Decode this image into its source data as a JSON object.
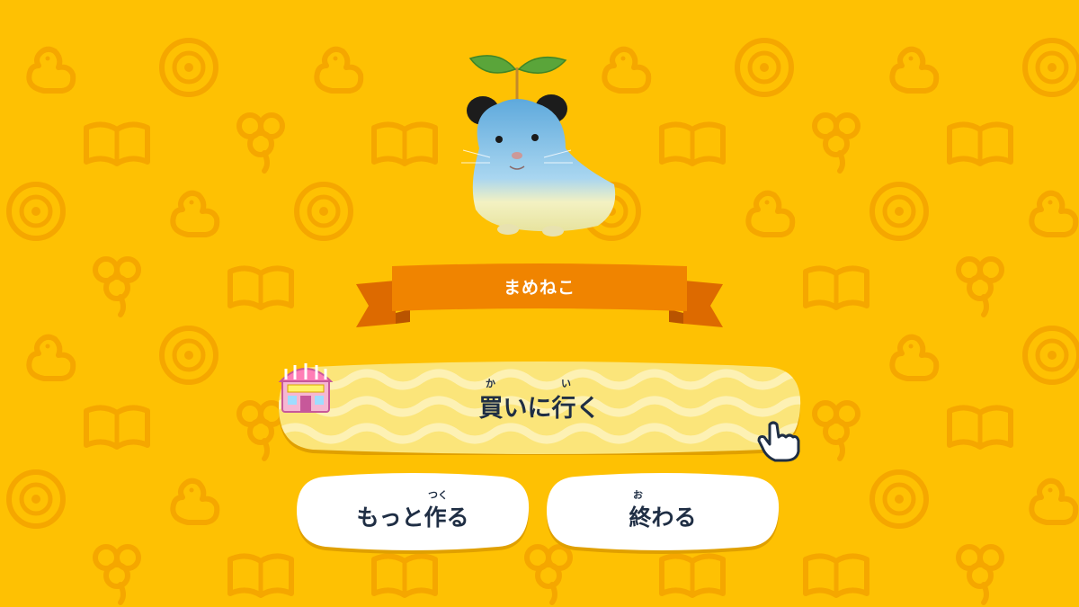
{
  "screen": {
    "background_color": "#fec103",
    "pattern_color": "#f5a600",
    "pattern_icons": [
      "duck-icon",
      "disc-icon",
      "book-icon",
      "clover-icon"
    ]
  },
  "character": {
    "name_label": "まめねこ",
    "image": "hamster-with-leaf-sprout"
  },
  "ribbon": {
    "color": "#f08400"
  },
  "buy_button": {
    "label": "買いに行く",
    "ruby_1": "か",
    "ruby_2": "い",
    "icon": "shop-icon"
  },
  "more_button": {
    "label": "もっと作る",
    "ruby": "つく"
  },
  "end_button": {
    "label": "終わる",
    "ruby": "お"
  },
  "cursor": {
    "icon": "pointing-hand-icon"
  }
}
